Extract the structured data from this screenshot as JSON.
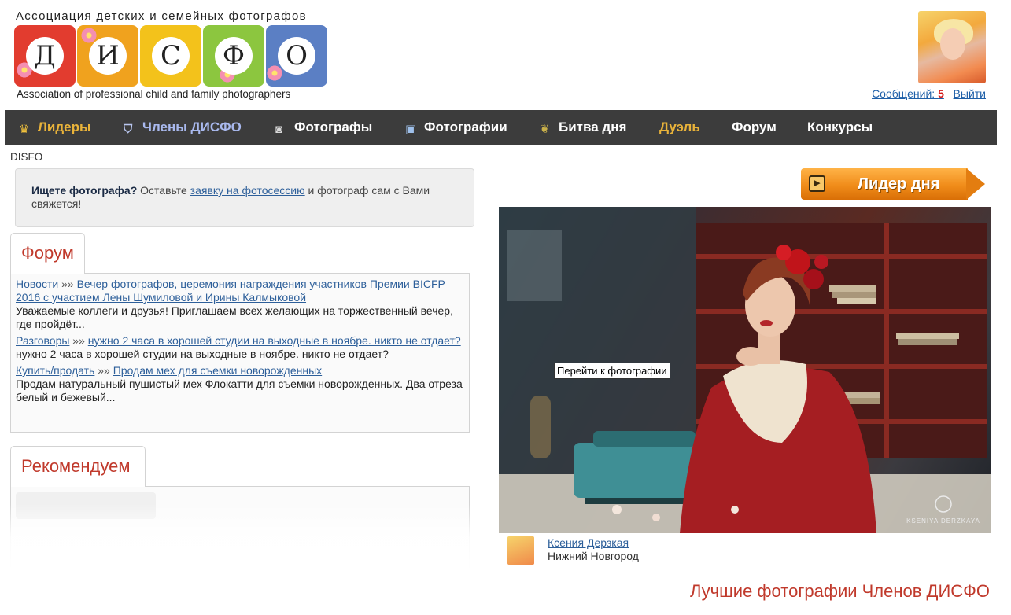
{
  "header": {
    "logo_top": "Ассоциация детских и семейных фотографов",
    "logo_letters": [
      "Д",
      "И",
      "С",
      "Ф",
      "О"
    ],
    "logo_bottom": "Association of professional child and family photographers",
    "messages_label": "Сообщений:",
    "messages_count": "5",
    "logout_label": "Выйти"
  },
  "colors": {
    "tiles": [
      "#e23c2f",
      "#f0a21e",
      "#f3c21b",
      "#8cc63f",
      "#5b7fc4"
    ],
    "nav_bg": "#3c3c3c",
    "accent_red": "#c0392b",
    "link_blue": "#2d5f9a"
  },
  "nav": {
    "items": [
      {
        "label": "Лидеры",
        "icon": "crown-icon"
      },
      {
        "label": "Члены ДИСФО",
        "icon": "shield-icon"
      },
      {
        "label": "Фотографы",
        "icon": "camera-icon"
      },
      {
        "label": "Фотографии",
        "icon": "photos-icon"
      },
      {
        "label": "Битва дня",
        "icon": "laurel-icon"
      },
      {
        "label": "Дуэль",
        "icon": ""
      },
      {
        "label": "Форум",
        "icon": ""
      },
      {
        "label": "Конкурсы",
        "icon": ""
      }
    ]
  },
  "breadcrumb": "DISFO",
  "notice": {
    "bold": "Ищете фотографа?",
    "text_before": " Оставьте ",
    "link": "заявку на фотосессию",
    "text_after": " и фотограф сам с Вами свяжется!"
  },
  "forum": {
    "tab_label": "Форум",
    "separator": " »» ",
    "entries": [
      {
        "category": "Новости",
        "title": "Вечер фотографов, церемония награждения участников Премии BICFP 2016 с участием Лены Шумиловой и Ирины Калмыковой",
        "excerpt": "Уважаемые коллеги и друзья! Приглашаем всех желающих на торжественный вечер, где пройдёт..."
      },
      {
        "category": "Разговоры",
        "title": "нужно 2 часа в хорошей студии на выходные в ноябре. никто не отдает?",
        "excerpt": "нужно 2 часа в хорошей студии на выходные в ноябре. никто не отдает?"
      },
      {
        "category": "Купить/продать",
        "title": "Продам мех для съемки новорожденных",
        "excerpt": "Продам натуральный пушистый мех Флокатти для съемки новорожденных. Два отреза белый и бежевый..."
      }
    ]
  },
  "recommend": {
    "tab_label": "Рекомендуем"
  },
  "leader_of_day": {
    "label": "Лидер дня"
  },
  "featured_photo": {
    "tooltip": "Перейти к фотографии",
    "watermark": "KSENIYA DERZKAYA",
    "author_name": "Ксения Дерзкая",
    "author_city": "Нижний Новгород"
  },
  "best_photos_title": "Лучшие фотографии Членов ДИСФО"
}
